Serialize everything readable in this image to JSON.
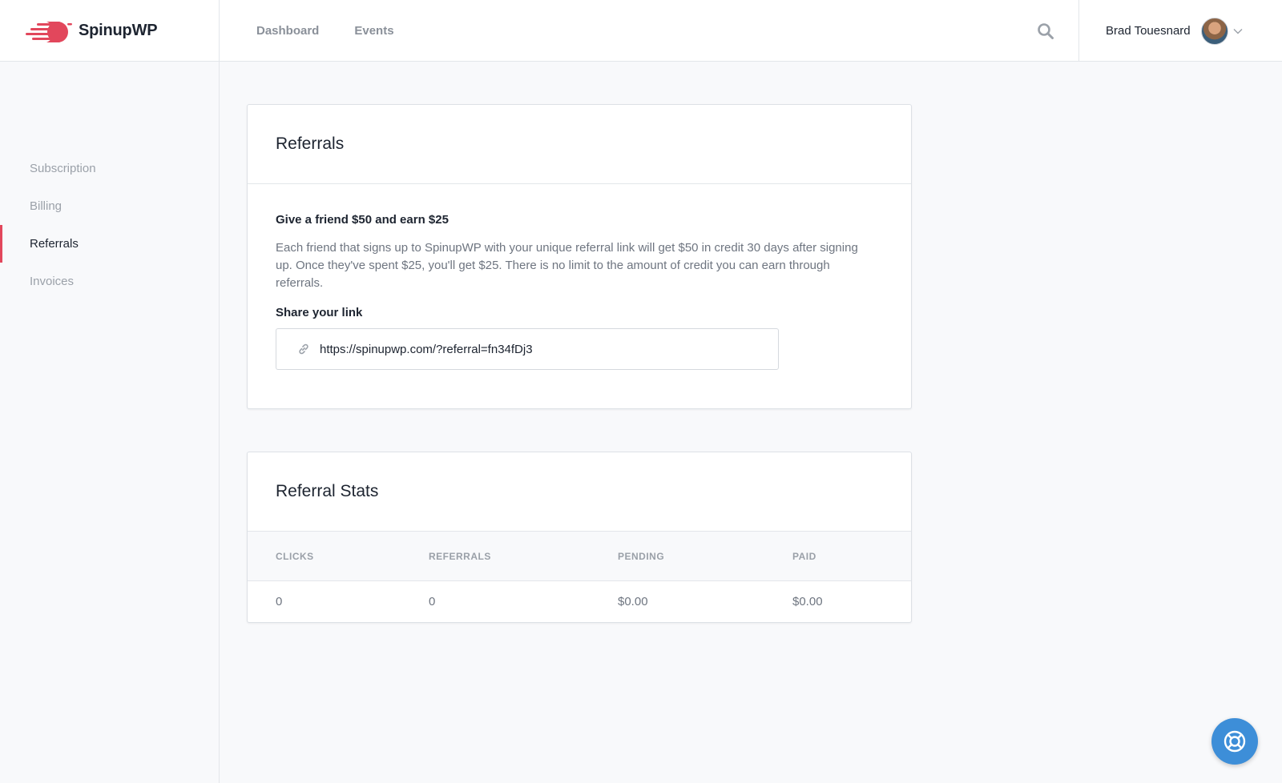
{
  "brand": {
    "name": "SpinupWP",
    "accent": "#e2475c"
  },
  "topnav": [
    {
      "label": "Dashboard"
    },
    {
      "label": "Events"
    }
  ],
  "user": {
    "name": "Brad Touesnard"
  },
  "sidebar": {
    "items": [
      {
        "label": "Subscription"
      },
      {
        "label": "Billing"
      },
      {
        "label": "Referrals",
        "active": true
      },
      {
        "label": "Invoices"
      }
    ]
  },
  "referrals": {
    "title": "Referrals",
    "offer_heading": "Give a friend $50 and earn $25",
    "description": "Each friend that signs up to SpinupWP with your unique referral link will get $50 in credit 30 days after signing up. Once they've spent $25, you'll get $25. There is no limit to the amount of credit you can earn through referrals.",
    "share_label": "Share your link",
    "link": "https://spinupwp.com/?referral=fn34fDj3"
  },
  "stats": {
    "title": "Referral Stats",
    "columns": [
      "CLICKS",
      "REFERRALS",
      "PENDING",
      "PAID"
    ],
    "values": [
      "0",
      "0",
      "$0.00",
      "$0.00"
    ]
  },
  "icons": {
    "search": "search-icon",
    "link": "link-icon",
    "help": "lifebuoy-icon",
    "chevron": "chevron-down-icon"
  },
  "colors": {
    "help_button": "#3d8ed8",
    "active_indicator": "#e2475c"
  }
}
